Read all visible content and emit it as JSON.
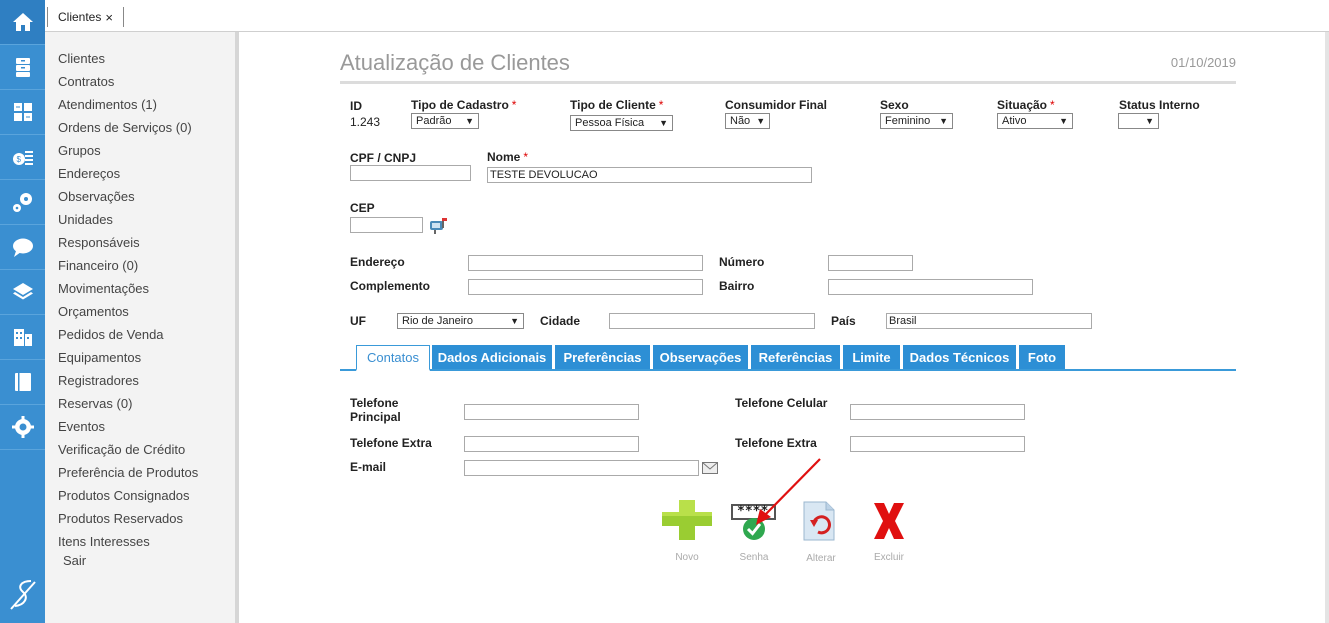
{
  "rail": {
    "icons": [
      "home-icon",
      "archive-icon",
      "calculator-icon",
      "money-icon",
      "gears-icon",
      "chat-icon",
      "layers-icon",
      "building-icon",
      "book-icon",
      "settings-icon"
    ],
    "logo": "brand-logo-icon"
  },
  "doc_tab": {
    "label": "Clientes",
    "close": "×"
  },
  "sidebar": {
    "items": [
      "Clientes",
      "Contratos",
      "Atendimentos (1)",
      "Ordens de Serviços (0)",
      "Grupos",
      "Endereços",
      "Observações",
      "Unidades",
      "Responsáveis",
      "Financeiro (0)",
      "Movimentações",
      "Orçamentos",
      "Pedidos de Venda",
      "Equipamentos",
      "Registradores",
      "Reservas (0)",
      "Eventos",
      "Verificação de Crédito",
      "Preferência de Produtos",
      "Produtos Consignados",
      "Produtos Reservados",
      "Itens Interesses"
    ],
    "sair": "Sair"
  },
  "page": {
    "title": "Atualização de Clientes",
    "date": "01/10/2019"
  },
  "form": {
    "id": {
      "label": "ID",
      "value": "1.243"
    },
    "tipo_cadastro": {
      "label": "Tipo de Cadastro",
      "value": "Padrão"
    },
    "tipo_cliente": {
      "label": "Tipo de Cliente",
      "value": "Pessoa Física"
    },
    "consumidor_final": {
      "label": "Consumidor Final",
      "value": "Não"
    },
    "sexo": {
      "label": "Sexo",
      "value": "Feminino"
    },
    "situacao": {
      "label": "Situação",
      "value": "Ativo"
    },
    "status_interno": {
      "label": "Status Interno",
      "value": ""
    },
    "cpf": {
      "label": "CPF / CNPJ",
      "value": ""
    },
    "nome": {
      "label": "Nome",
      "value": "TESTE DEVOLUCAO"
    },
    "cep": {
      "label": "CEP",
      "value": ""
    },
    "endereco": {
      "label": "Endereço",
      "value": ""
    },
    "numero": {
      "label": "Número",
      "value": ""
    },
    "complemento": {
      "label": "Complemento",
      "value": ""
    },
    "bairro": {
      "label": "Bairro",
      "value": ""
    },
    "uf": {
      "label": "UF",
      "value": "Rio de Janeiro"
    },
    "cidade": {
      "label": "Cidade",
      "value": ""
    },
    "pais": {
      "label": "País",
      "value": "Brasil"
    },
    "required_mark": "*",
    "arrow": "▼"
  },
  "tabs": [
    "Contatos",
    "Dados Adicionais",
    "Preferências",
    "Observações",
    "Referências",
    "Limite",
    "Dados Técnicos",
    "Foto"
  ],
  "contacts": {
    "tel_principal": {
      "label": "Telefone Principal",
      "value": ""
    },
    "tel_celular": {
      "label": "Telefone Celular",
      "value": ""
    },
    "tel_extra1": {
      "label": "Telefone Extra",
      "value": ""
    },
    "tel_extra2": {
      "label": "Telefone Extra",
      "value": ""
    },
    "email": {
      "label": "E-mail",
      "value": ""
    }
  },
  "actions": {
    "novo": "Novo",
    "senha": "Senha",
    "senha_mask": "****",
    "alterar": "Alterar",
    "excluir": "Excluir"
  },
  "colors": {
    "accent": "#3a8fd1",
    "tab": "#2d8fd5",
    "novo": "#9acd32",
    "excluir": "#e01010",
    "arrow": "#e01010"
  }
}
